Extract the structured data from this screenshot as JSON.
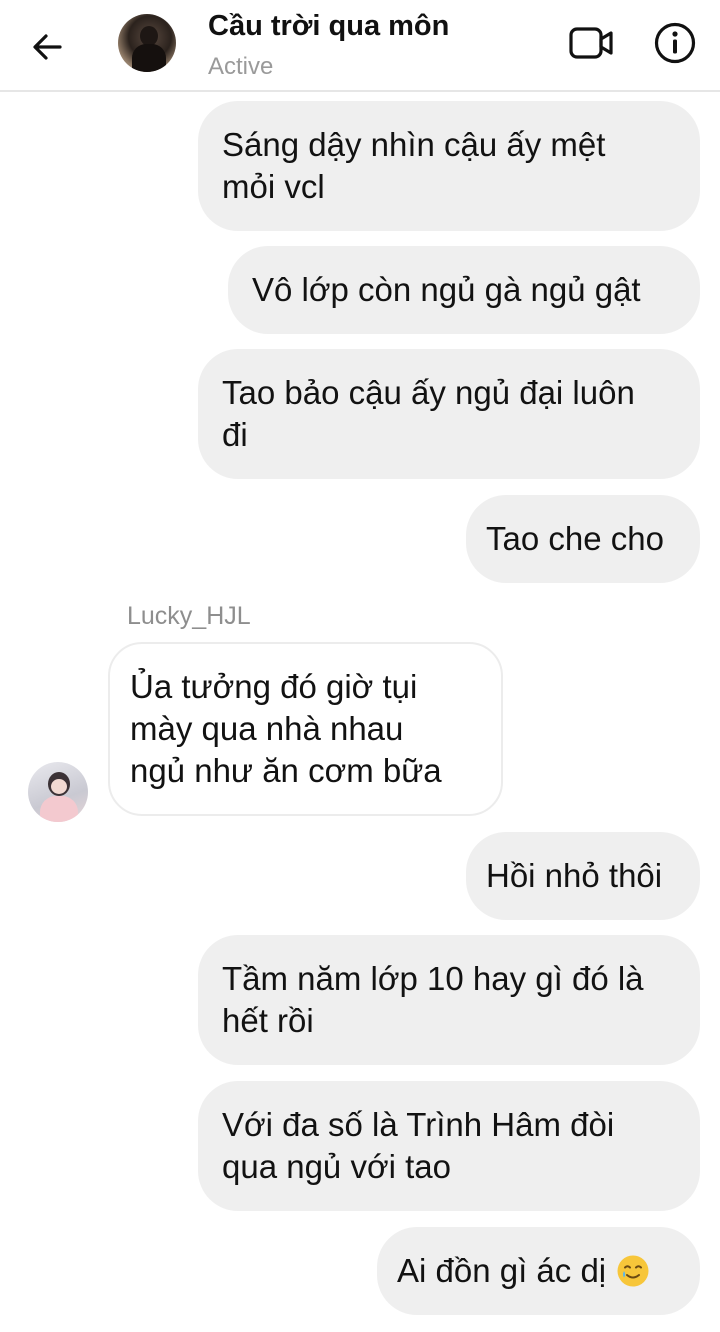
{
  "header": {
    "title": "Cầu trời qua môn",
    "status": "Active",
    "back_icon": "arrow-left-icon",
    "video_icon": "video-call-icon",
    "info_icon": "info-icon"
  },
  "sender": {
    "name": "Lucky_HJL"
  },
  "messages": [
    {
      "text": "Sáng dậy nhìn cậu ấy mệt\nmỏi vcl",
      "direction": "outgoing"
    },
    {
      "text": "Vô lớp còn ngủ gà ngủ gật",
      "direction": "outgoing"
    },
    {
      "text": "Tao bảo cậu ấy ngủ đại luôn\nđi",
      "direction": "outgoing"
    },
    {
      "text": "Tao che cho",
      "direction": "outgoing"
    },
    {
      "text": "Ủa tưởng đó giờ tụi\nmày qua nhà nhau\nngủ như ăn cơm bữa",
      "direction": "incoming"
    },
    {
      "text": "Hồi nhỏ thôi",
      "direction": "outgoing"
    },
    {
      "text": "Tầm năm lớp 10 hay gì đó là\nhết rồi",
      "direction": "outgoing"
    },
    {
      "text": "Với đa số là Trình Hâm đòi\nqua ngủ với tao",
      "direction": "outgoing"
    },
    {
      "text": "Ai đồn gì ác dị",
      "direction": "outgoing",
      "emoji": "smiling-face-with-tear-icon"
    }
  ],
  "colors": {
    "outgoing_bubble": "#efefef",
    "incoming_bubble": "#ffffff",
    "text": "#121212",
    "muted": "#9a9a9a"
  }
}
